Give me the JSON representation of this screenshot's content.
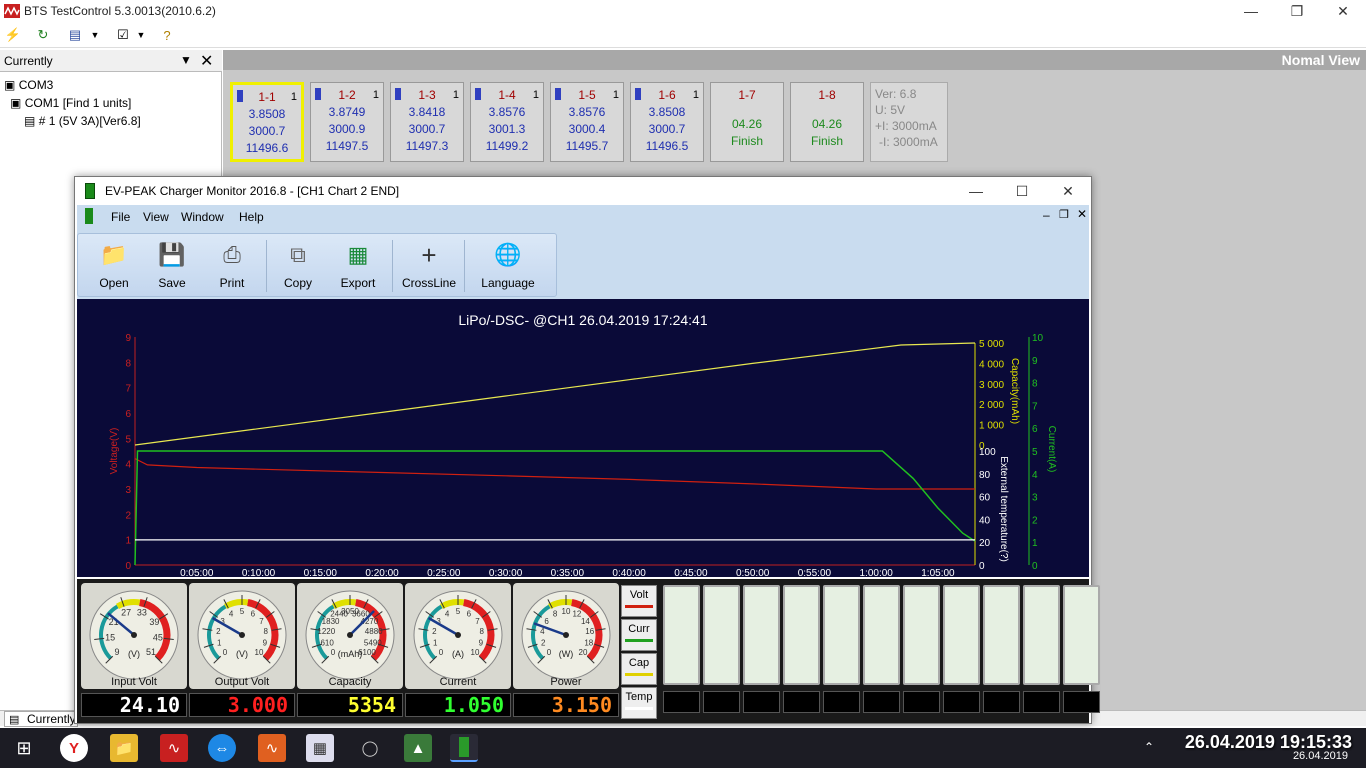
{
  "bts": {
    "title": "BTS TestControl 5.3.0013(2010.6.2)",
    "panel_title": "Currently",
    "tree": {
      "com3": "COM3",
      "com1": "COM1 [Find 1 units]",
      "unit": "# 1 (5V  3A)[Ver6.8]"
    },
    "view_label": "Nomal View",
    "status_tab": "Currently",
    "channels": [
      {
        "label": "1-1",
        "num": "1",
        "v1": "3.8508",
        "v2": "3000.7",
        "v3": "11496.6",
        "selected": true
      },
      {
        "label": "1-2",
        "num": "1",
        "v1": "3.8749",
        "v2": "3000.9",
        "v3": "11497.5"
      },
      {
        "label": "1-3",
        "num": "1",
        "v1": "3.8418",
        "v2": "3000.7",
        "v3": "11497.3"
      },
      {
        "label": "1-4",
        "num": "1",
        "v1": "3.8576",
        "v2": "3001.3",
        "v3": "11499.2"
      },
      {
        "label": "1-5",
        "num": "1",
        "v1": "3.8576",
        "v2": "3000.4",
        "v3": "11495.7"
      },
      {
        "label": "1-6",
        "num": "1",
        "v1": "3.8508",
        "v2": "3000.7",
        "v3": "11496.5"
      },
      {
        "label": "1-7",
        "date": "04.26",
        "status": "Finish"
      },
      {
        "label": "1-8",
        "date": "04.26",
        "status": "Finish"
      }
    ],
    "version_box": [
      "Ver: 6.8",
      "U: 5V",
      "+I: 3000mA",
      "-I: 3000mA"
    ]
  },
  "ev": {
    "title": "EV-PEAK Charger Monitor 2016.8 - [CH1 Chart 2 END]",
    "menu": [
      "File",
      "View",
      "Window",
      "Help"
    ],
    "tools": [
      "Open",
      "Save",
      "Print",
      "Copy",
      "Export",
      "CrossLine",
      "Language"
    ],
    "gauges": [
      {
        "label": "Input Volt",
        "unit": "(V)",
        "ticks": [
          "9",
          "15",
          "21",
          "27",
          "33",
          "39",
          "45",
          "51"
        ],
        "lcd": "24.10",
        "lcd_color": "#ffffff"
      },
      {
        "label": "Output Volt",
        "unit": "(V)",
        "ticks": [
          "0",
          "1",
          "2",
          "3",
          "4",
          "5",
          "6",
          "7",
          "8",
          "9",
          "10"
        ],
        "lcd": "3.000",
        "lcd_color": "#ff2020"
      },
      {
        "label": "Capacity",
        "unit": "(mAh)",
        "ticks": [
          "0",
          "610",
          "1220",
          "1830",
          "2440",
          "3050",
          "3660",
          "4270",
          "4880",
          "5490",
          "6100"
        ],
        "lcd": "5354",
        "lcd_color": "#ffff30"
      },
      {
        "label": "Current",
        "unit": "(A)",
        "ticks": [
          "0",
          "1",
          "2",
          "3",
          "4",
          "5",
          "6",
          "7",
          "8",
          "9",
          "10"
        ],
        "lcd": "1.050",
        "lcd_color": "#30ff30"
      },
      {
        "label": "Power",
        "unit": "(W)",
        "ticks": [
          "0",
          "2",
          "4",
          "6",
          "8",
          "10",
          "12",
          "14",
          "16",
          "18",
          "20"
        ],
        "lcd": "3.150",
        "lcd_color": "#ff8a20"
      }
    ],
    "legend": [
      "Volt",
      "Curr",
      "Cap",
      "Temp"
    ]
  },
  "chart_data": {
    "type": "line",
    "title": "LiPo/-DSC-    @CH1  26.04.2019  17:24:41",
    "x_ticks": [
      "0:05:00",
      "0:10:00",
      "0:15:00",
      "0:20:00",
      "0:25:00",
      "0:30:00",
      "0:35:00",
      "0:40:00",
      "0:45:00",
      "0:50:00",
      "0:55:00",
      "1:00:00",
      "1:05:00"
    ],
    "xlim_minutes": [
      0,
      68
    ],
    "axes": {
      "voltage": {
        "label": "Voltage(V)",
        "ylim": [
          0,
          9
        ],
        "ticks": [
          "0",
          "1",
          "2",
          "3",
          "4",
          "5",
          "6",
          "7",
          "8",
          "9"
        ],
        "color": "#cc2020"
      },
      "capacity": {
        "label": "Capacity(mAh)",
        "ylim": [
          0,
          5000
        ],
        "ticks": [
          "0",
          "1 000",
          "2 000",
          "3 000",
          "4 000",
          "5 000"
        ],
        "color": "#e0e000"
      },
      "temperature": {
        "label": "External temperature(?)",
        "ylim": [
          0,
          100
        ],
        "ticks": [
          "0",
          "20",
          "40",
          "60",
          "80",
          "100"
        ],
        "color": "#ffffff"
      },
      "current": {
        "label": "Current(A)",
        "ylim": [
          0,
          10
        ],
        "ticks": [
          "0",
          "1",
          "2",
          "3",
          "4",
          "5",
          "6",
          "7",
          "8",
          "9",
          "10"
        ],
        "color": "#20c020"
      }
    },
    "series": [
      {
        "name": "Volt",
        "axis": "voltage",
        "color": "#d02010",
        "x": [
          0,
          1,
          5,
          10,
          20,
          30,
          40,
          50,
          60,
          68
        ],
        "y": [
          4.2,
          3.95,
          3.85,
          3.78,
          3.65,
          3.52,
          3.38,
          3.2,
          3.0,
          3.0
        ]
      },
      {
        "name": "Cap",
        "axis": "capacity",
        "color": "#e8e850",
        "x": [
          0,
          10,
          20,
          30,
          40,
          50,
          58,
          62,
          68
        ],
        "y": [
          0,
          800,
          1600,
          2400,
          3200,
          4000,
          4600,
          4900,
          5000
        ]
      },
      {
        "name": "Curr",
        "axis": "current",
        "color": "#20c020",
        "x": [
          0,
          0.2,
          60.5,
          63,
          65,
          67,
          68
        ],
        "y": [
          0,
          5,
          5,
          3.8,
          2.5,
          1.4,
          1.05
        ]
      },
      {
        "name": "Temp",
        "axis": "temperature",
        "color": "#ffffff",
        "x": [
          0,
          68
        ],
        "y": [
          22,
          22
        ]
      }
    ]
  },
  "taskbar": {
    "clock_big": "26.04.2019  19:15:33",
    "clock_small": "26.04.2019"
  }
}
